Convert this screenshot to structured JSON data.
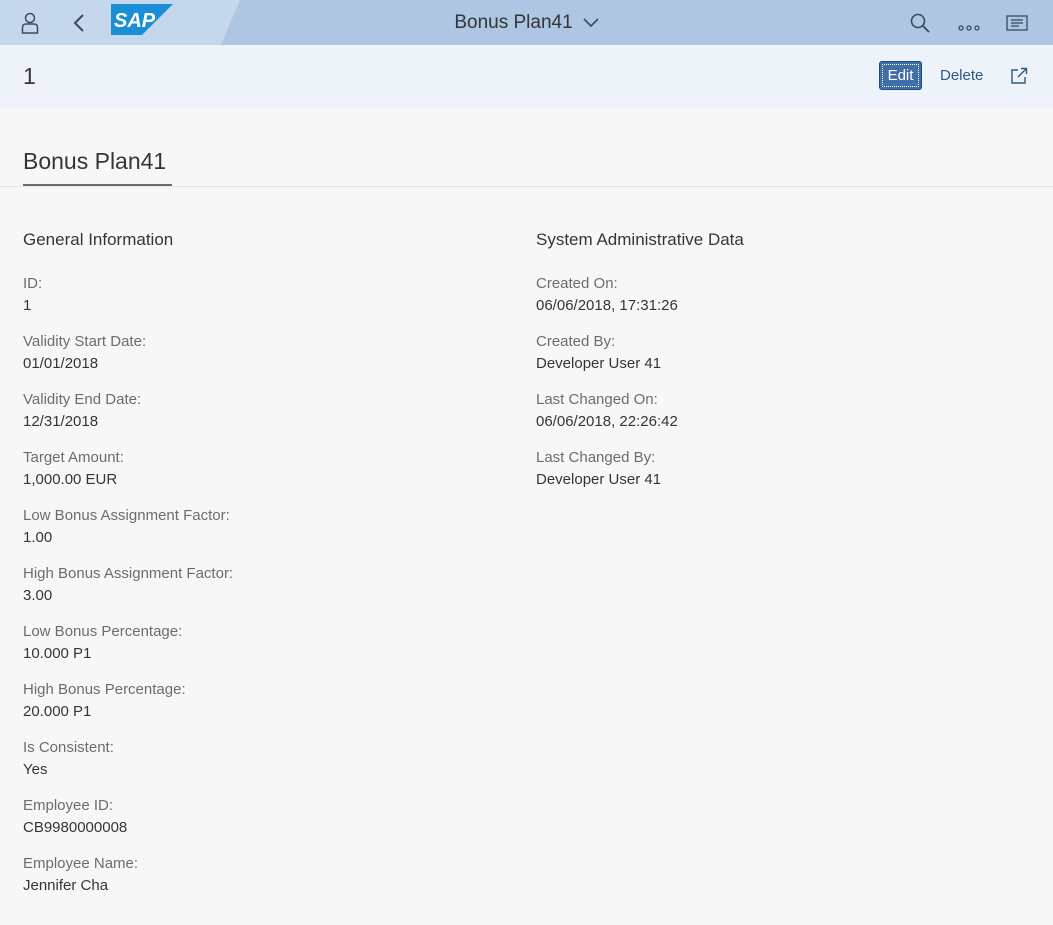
{
  "shell": {
    "logo": "SAP",
    "title": "Bonus Plan41"
  },
  "header": {
    "object_title": "1",
    "edit_label": "Edit",
    "delete_label": "Delete"
  },
  "tab": {
    "label": "Bonus Plan41"
  },
  "general": {
    "title": "General Information",
    "fields": [
      {
        "label": "ID:",
        "value": "1"
      },
      {
        "label": "Validity Start Date:",
        "value": "01/01/2018"
      },
      {
        "label": "Validity End Date:",
        "value": "12/31/2018"
      },
      {
        "label": "Target Amount:",
        "value": "1,000.00  EUR"
      },
      {
        "label": "Low Bonus Assignment Factor:",
        "value": "1.00"
      },
      {
        "label": "High Bonus Assignment Factor:",
        "value": "3.00"
      },
      {
        "label": "Low Bonus Percentage:",
        "value": "10.000 P1"
      },
      {
        "label": "High Bonus Percentage:",
        "value": "20.000 P1"
      },
      {
        "label": "Is Consistent:",
        "value": "Yes"
      },
      {
        "label": "Employee ID:",
        "value": "CB9980000008"
      },
      {
        "label": "Employee Name:",
        "value": "Jennifer Cha"
      }
    ]
  },
  "admin": {
    "title": "System Administrative Data",
    "fields": [
      {
        "label": "Created On:",
        "value": "06/06/2018, 17:31:26"
      },
      {
        "label": "Created By:",
        "value": "Developer User 41"
      },
      {
        "label": "Last Changed On:",
        "value": "06/06/2018, 22:26:42"
      },
      {
        "label": "Last Changed By:",
        "value": "Developer User 41"
      }
    ]
  },
  "colors": {
    "shell_bg": "#aec6e2",
    "header_bg": "#eef3fa",
    "emphasized_button": "#3f6ea8",
    "link_text": "#2a5a8c",
    "sap_logo_blue": "#1a8fd8"
  },
  "icons": {
    "profile": "person-icon",
    "back": "chevron-left-icon",
    "title_menu": "chevron-down-icon",
    "search": "search-icon",
    "more": "overflow-dots-icon",
    "notifications": "notification-list-icon",
    "share": "share-icon"
  }
}
